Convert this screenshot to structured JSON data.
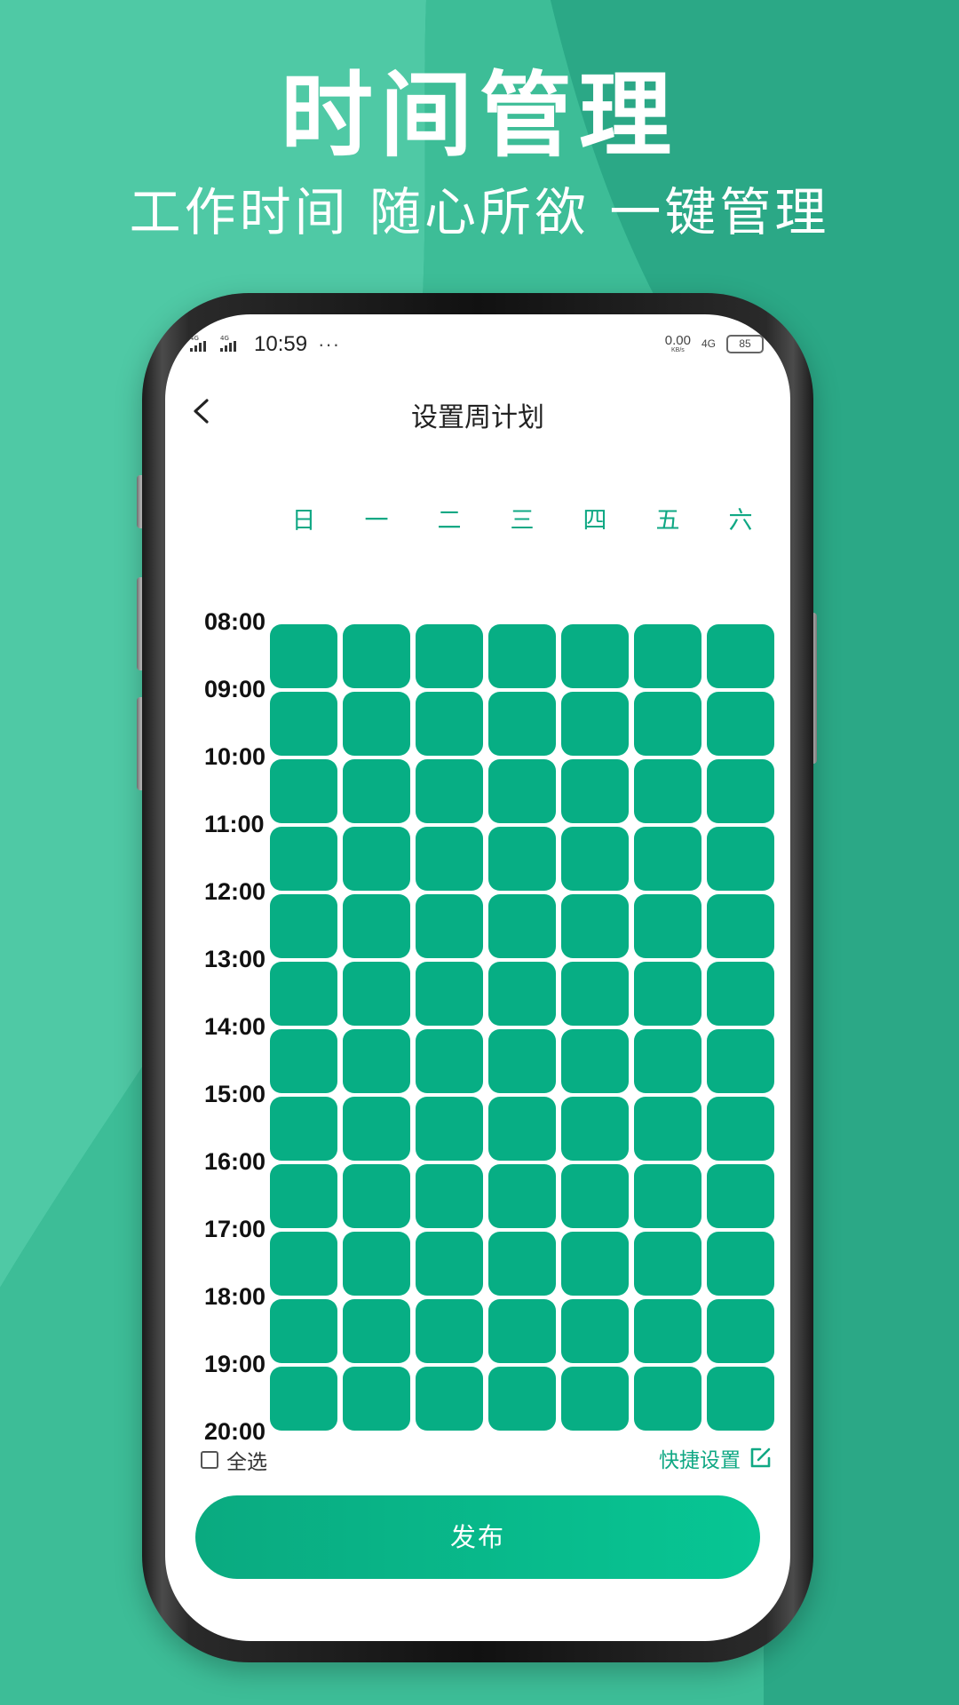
{
  "promo": {
    "title": "时间管理",
    "subtitle": "工作时间 随心所欲 一键管理"
  },
  "status_bar": {
    "signal_1": "4G",
    "signal_2": "4G",
    "time": "10:59",
    "more": "···",
    "net_speed_value": "0.00",
    "net_speed_unit": "KB/s",
    "net_type": "4G",
    "battery": "85"
  },
  "nav": {
    "title": "设置周计划",
    "back_icon": "chevron-left-icon"
  },
  "weekdays": [
    "日",
    "一",
    "二",
    "三",
    "四",
    "五",
    "六"
  ],
  "times": [
    "08:00",
    "09:00",
    "10:00",
    "11:00",
    "12:00",
    "13:00",
    "14:00",
    "15:00",
    "16:00",
    "17:00",
    "18:00",
    "19:00",
    "20:00"
  ],
  "slot_rows": 12,
  "slot_state": "selected",
  "colors": {
    "accent": "#07ae84",
    "accent_text": "#10a884",
    "background": "#2aae8a"
  },
  "bottom": {
    "select_all_label": "全选",
    "select_all_checked": false,
    "quick_set_label": "快捷设置",
    "quick_set_icon": "edit-icon",
    "publish_label": "发布"
  }
}
